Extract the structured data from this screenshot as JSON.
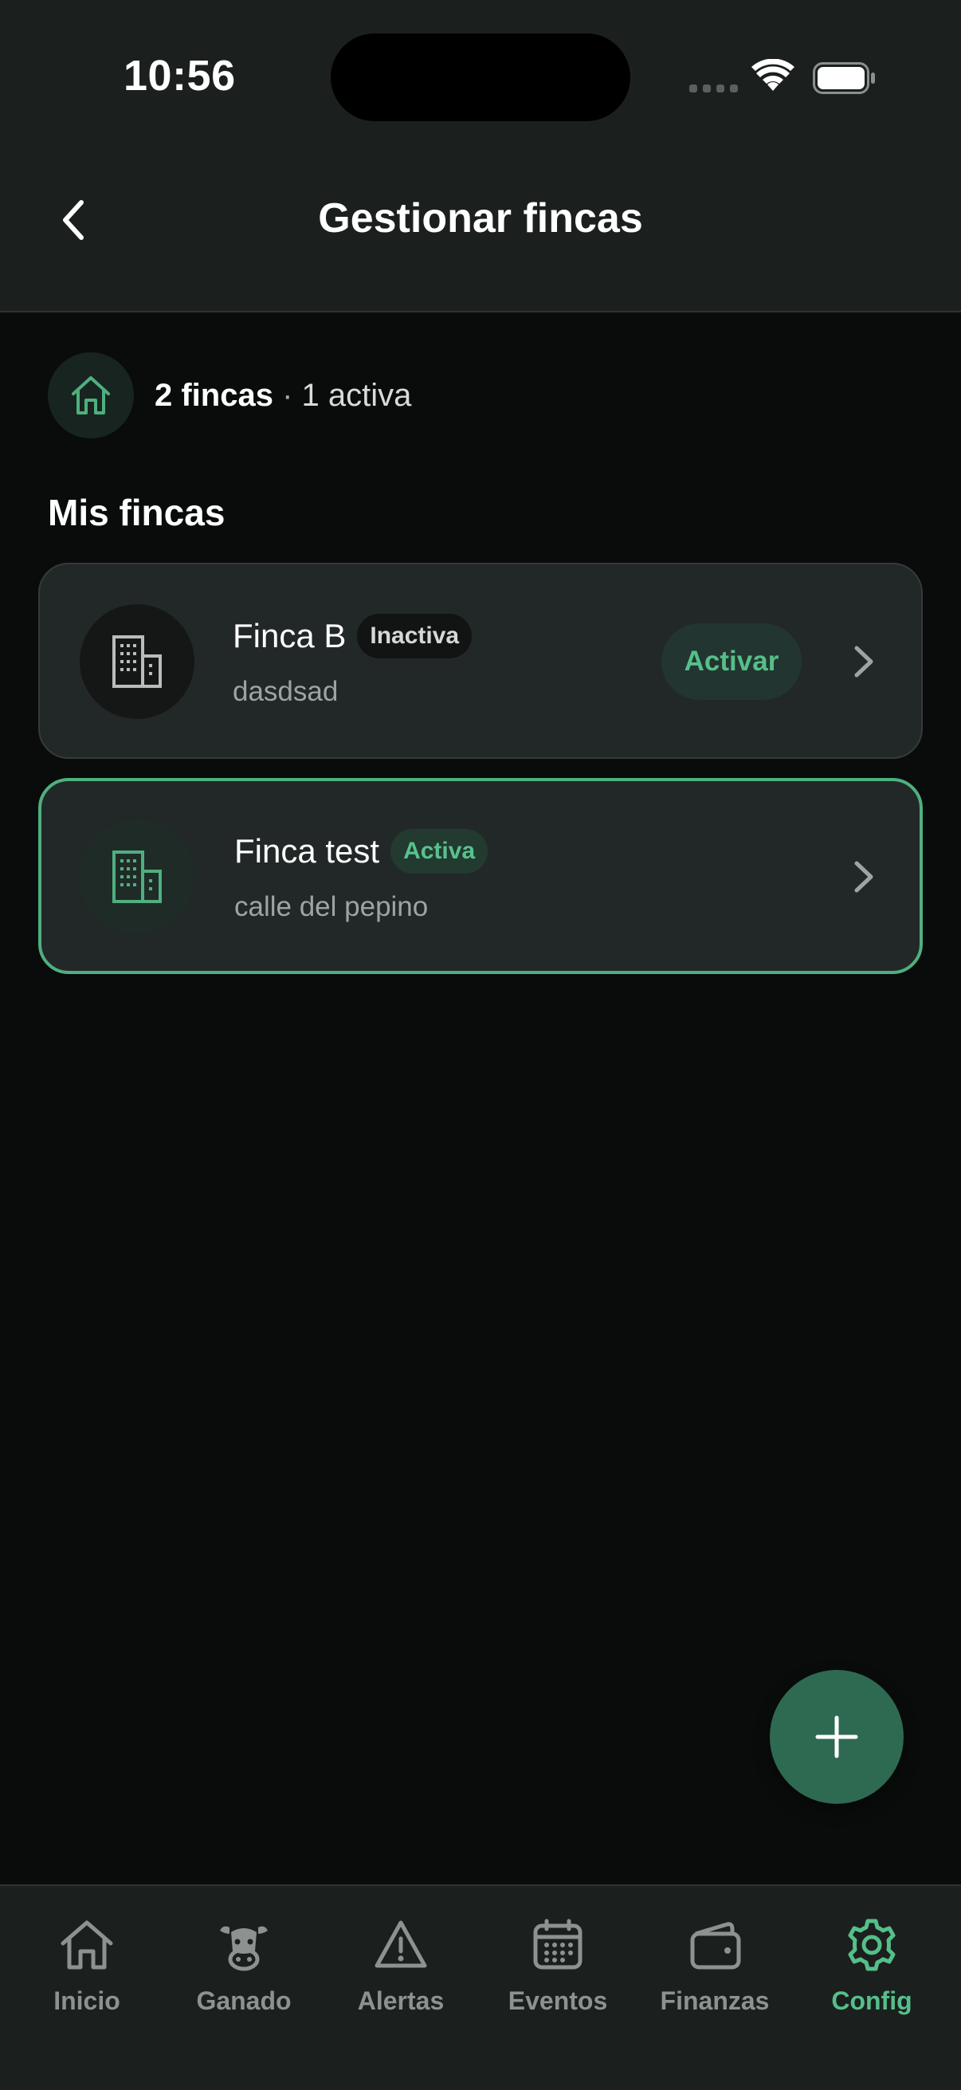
{
  "status_bar": {
    "time": "10:56"
  },
  "header": {
    "title": "Gestionar fincas"
  },
  "summary": {
    "count": "2 fincas",
    "separator": " · ",
    "active": "1 activa"
  },
  "section": {
    "title": "Mis fincas"
  },
  "farms": [
    {
      "name": "Finca B",
      "status": "Inactiva",
      "address": "dasdsad",
      "action_label": "Activar"
    },
    {
      "name": "Finca test",
      "status": "Activa",
      "address": "calle del pepino"
    }
  ],
  "tabs": [
    {
      "label": "Inicio",
      "icon": "home-icon"
    },
    {
      "label": "Ganado",
      "icon": "cow-icon"
    },
    {
      "label": "Alertas",
      "icon": "warning-icon"
    },
    {
      "label": "Eventos",
      "icon": "calendar-icon"
    },
    {
      "label": "Finanzas",
      "icon": "wallet-icon"
    },
    {
      "label": "Config",
      "icon": "gear-icon",
      "selected": true
    }
  ],
  "colors": {
    "accent": "#55bf8a",
    "fab": "#2e6a51",
    "background": "#0a0c0c",
    "card": "#222827"
  }
}
